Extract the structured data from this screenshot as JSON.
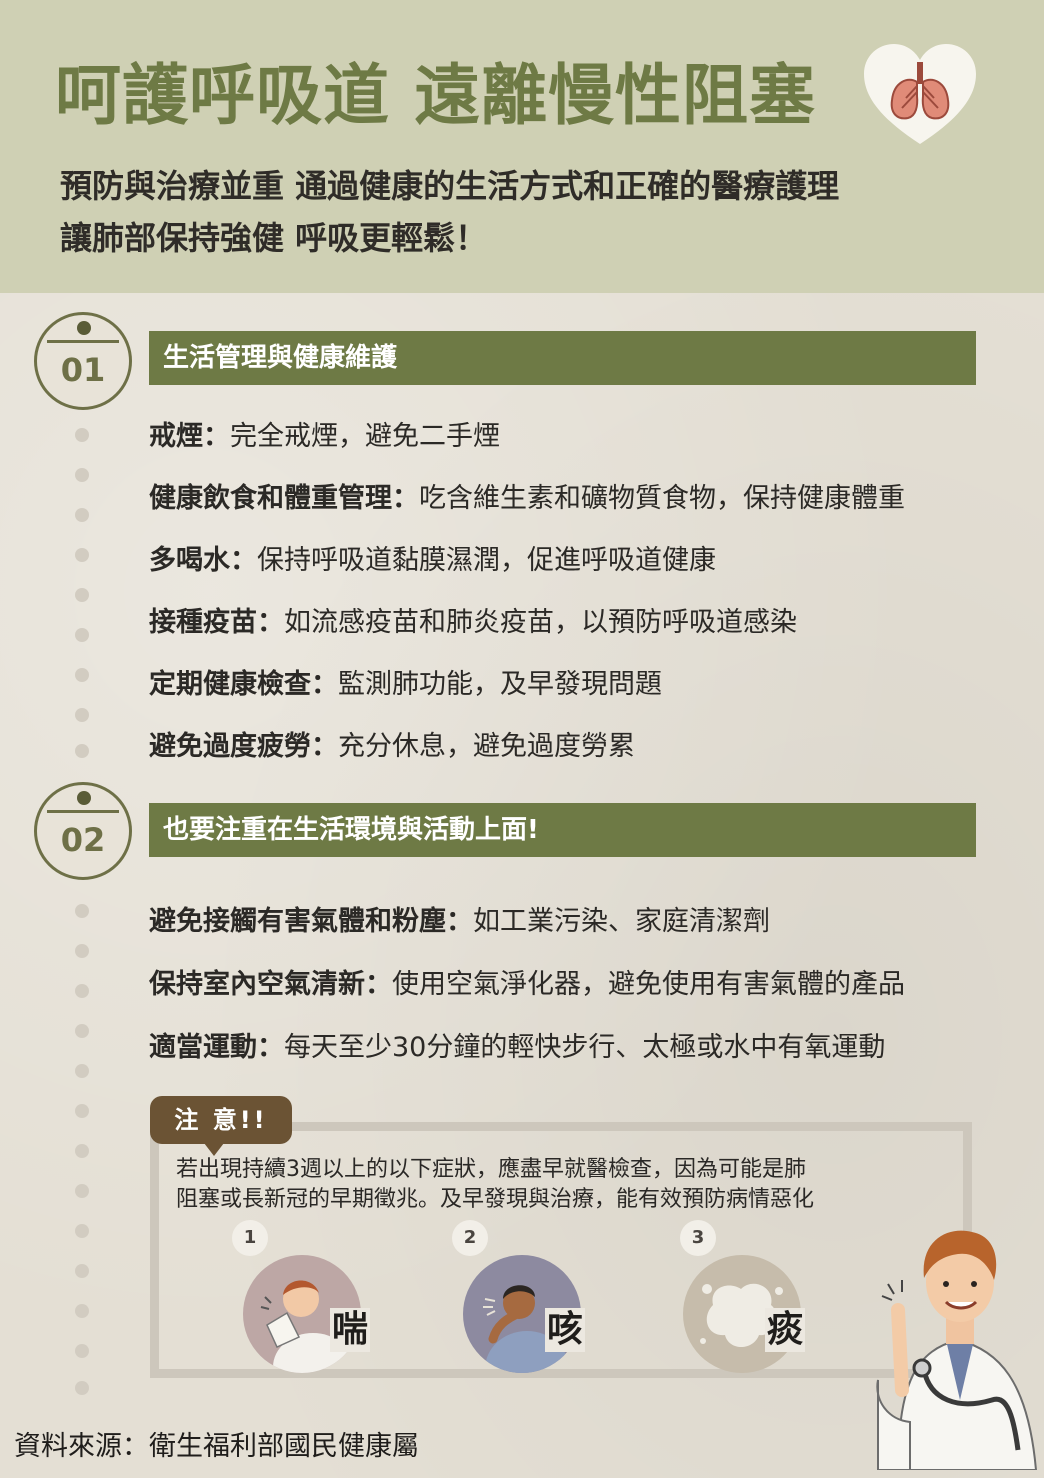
{
  "header": {
    "title": "呵護呼吸道 遠離慢性阻塞",
    "subtitle_line1": "預防與治療並重  通過健康的生活方式和正確的醫療護理",
    "subtitle_line2": "讓肺部保持強健  呼吸更輕鬆！"
  },
  "section1": {
    "number": "01",
    "heading": "生活管理與健康維護",
    "items": [
      {
        "key": "戒煙：",
        "text": "完全戒煙，避免二手煙"
      },
      {
        "key": "健康飲食和體重管理：",
        "text": "吃含維生素和礦物質食物，保持健康體重"
      },
      {
        "key": "多喝水：",
        "text": "保持呼吸道黏膜濕潤，促進呼吸道健康"
      },
      {
        "key": "接種疫苗：",
        "text": "如流感疫苗和肺炎疫苗，以預防呼吸道感染"
      },
      {
        "key": "定期健康檢查：",
        "text": "監測肺功能，及早發現問題"
      },
      {
        "key": "避免過度疲勞：",
        "text": "充分休息，避免過度勞累"
      }
    ]
  },
  "section2": {
    "number": "02",
    "heading": "也要注重在生活環境與活動上面!",
    "items": [
      {
        "key": "避免接觸有害氣體和粉塵：",
        "text": "如工業污染、家庭清潔劑"
      },
      {
        "key": "保持室內空氣清新：",
        "text": "使用空氣淨化器，避免使用有害氣體的產品"
      },
      {
        "key": "適當運動：",
        "text": "每天至少30分鐘的輕快步行、太極或水中有氧運動"
      }
    ]
  },
  "notice": {
    "tag": "注 意!!",
    "line1": "若出現持續3週以上的以下症狀，應盡早就醫檢查，因為可能是肺",
    "line2": "阻塞或長新冠的早期徵兆。及早發現與治療，能有效預防病情惡化",
    "symptoms": [
      {
        "num": "1",
        "label": "喘"
      },
      {
        "num": "2",
        "label": "咳"
      },
      {
        "num": "3",
        "label": "痰"
      }
    ]
  },
  "source": "資料來源：衛生福利部國民健康屬",
  "colors": {
    "header_bg": "#cfd0b4",
    "title": "#6e7a45",
    "section_bar": "#6e7a45",
    "notice_tag": "#6b5334"
  }
}
